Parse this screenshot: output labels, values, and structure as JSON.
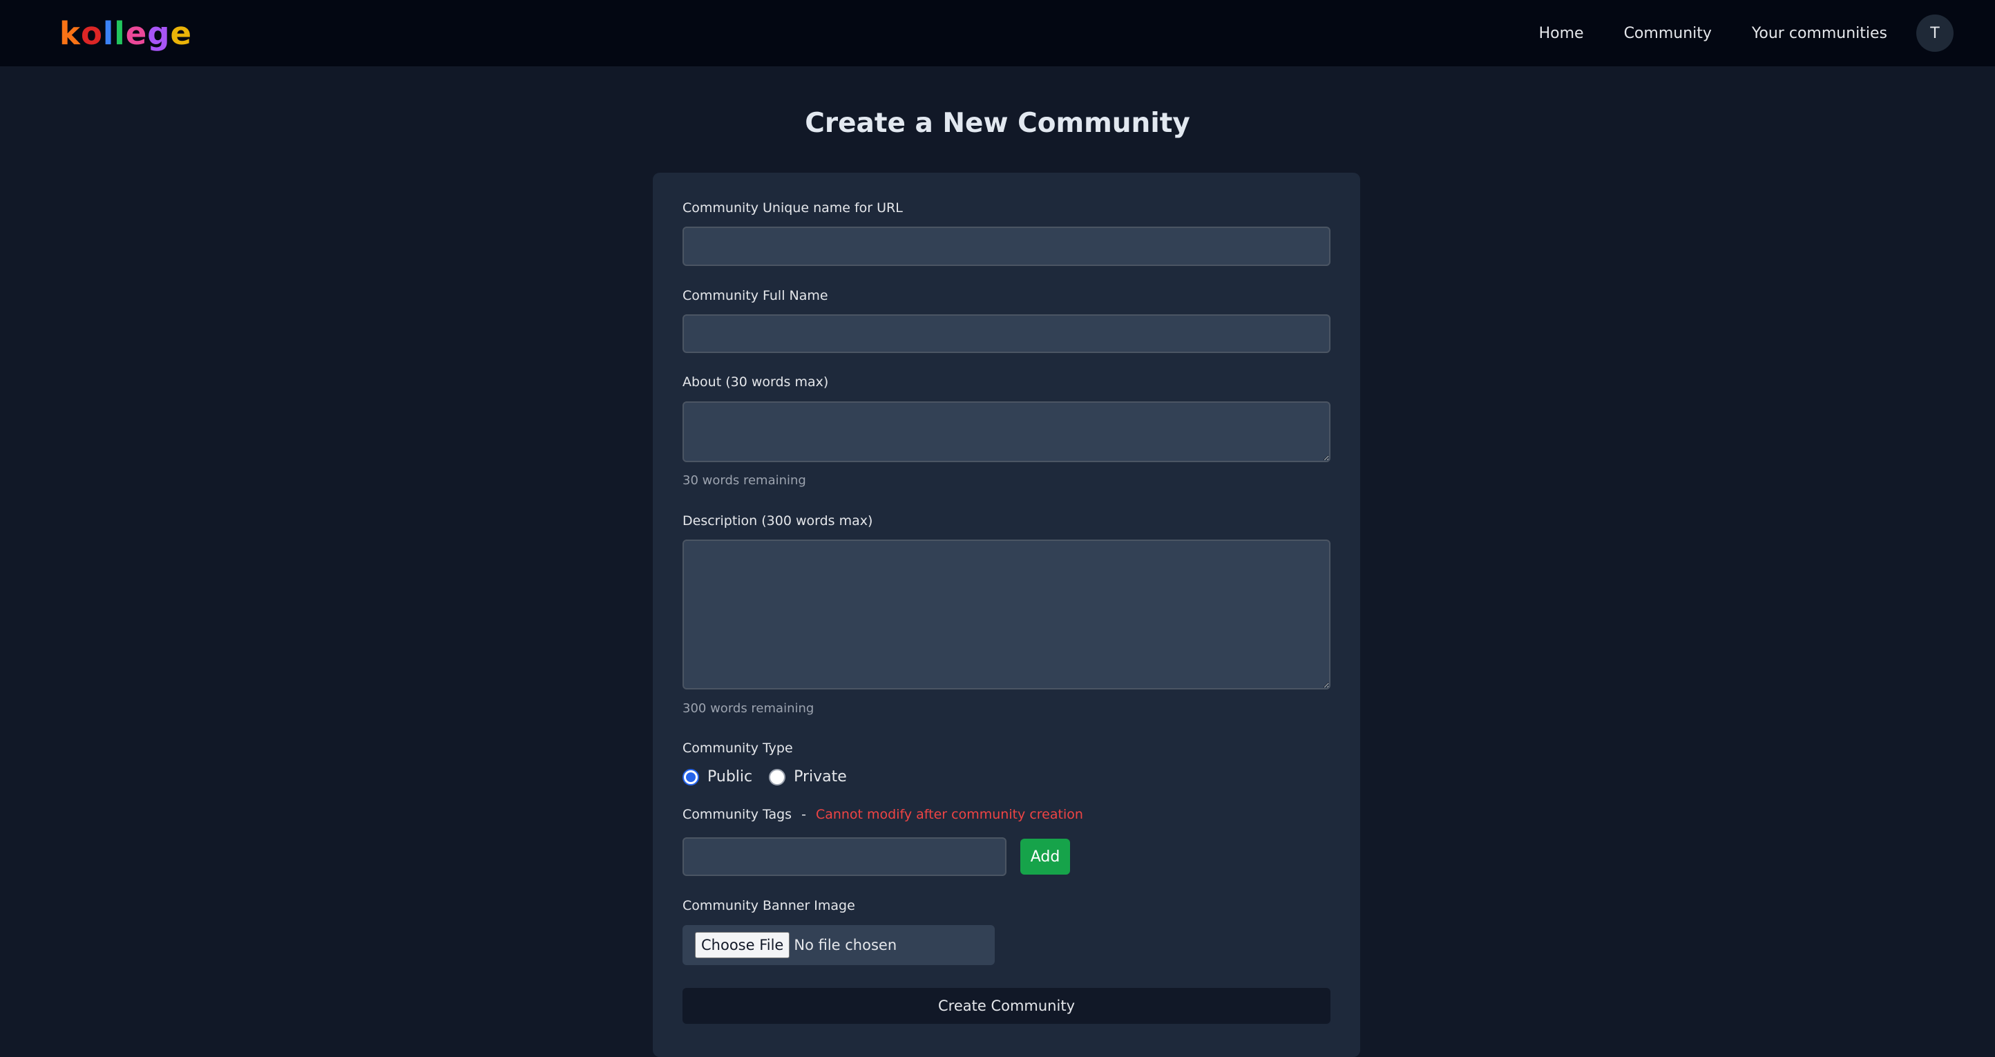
{
  "navbar": {
    "logo_letters": [
      {
        "char": "k",
        "color": "#f97316"
      },
      {
        "char": "o",
        "color": "#dc2626"
      },
      {
        "char": "l",
        "color": "#3b82f6"
      },
      {
        "char": "l",
        "color": "#22c55e"
      },
      {
        "char": "e",
        "color": "#ec4899"
      },
      {
        "char": "g",
        "color": "#a855f7"
      },
      {
        "char": "e",
        "color": "#eab308"
      }
    ],
    "links": [
      "Home",
      "Community",
      "Your communities"
    ],
    "avatar_initial": "T"
  },
  "page": {
    "title": "Create a New Community"
  },
  "form": {
    "unique_name_label": "Community Unique name for URL",
    "unique_name_value": "",
    "full_name_label": "Community Full Name",
    "full_name_value": "",
    "about_label": "About (30 words max)",
    "about_value": "",
    "about_hint": "30 words remaining",
    "description_label": "Description (300 words max)",
    "description_value": "",
    "description_hint": "300 words remaining",
    "type_label": "Community Type",
    "type_options": [
      "Public",
      "Private"
    ],
    "type_selected": "Public",
    "tags_label": "Community Tags",
    "tags_separator": "-",
    "tags_warning": "Cannot modify after community creation",
    "tags_value": "",
    "add_button": "Add",
    "banner_label": "Community Banner Image",
    "choose_file_button": "Choose File",
    "no_file_text": "No file chosen",
    "submit_button": "Create Community"
  },
  "colors": {
    "page_bg": "#111827",
    "navbar_bg": "#030712",
    "card_bg": "#1e293b",
    "input_bg": "#334155",
    "accent_green": "#16a34a",
    "warning_red": "#ef4444",
    "radio_blue": "#2563eb"
  }
}
